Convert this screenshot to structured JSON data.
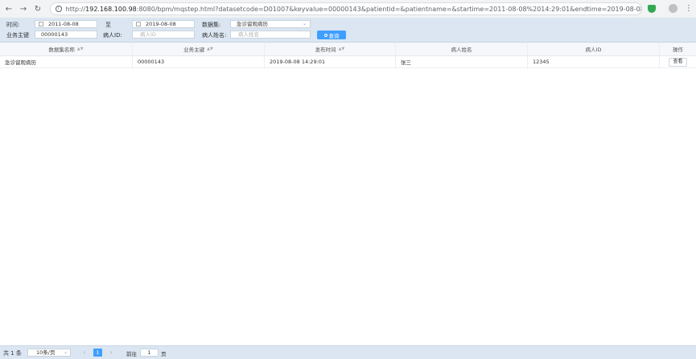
{
  "browser": {
    "url_host": "192.168.100.98",
    "url_rest": ":8080/bpm/mqstep.html?datasetcode=D01007&keyvalue=00000143&patientid=&patientname=&startime=2011-08-08%2014:29:01&endtime=2019-08-08%2014:..."
  },
  "filters": {
    "time_label": "时间:",
    "start_date": "2011-08-08",
    "to_label": "至",
    "end_date": "2019-08-08",
    "dataset_label": "数据集:",
    "dataset_value": "急诊留观病历",
    "business_key_label": "业务主键",
    "business_key_value": "00000143",
    "patient_id_label": "病人ID:",
    "patient_id_placeholder": "病人ID",
    "patient_name_label": "病人姓名:",
    "patient_name_placeholder": "病人姓名",
    "search_label": "查询"
  },
  "table": {
    "columns": [
      "数据集名称",
      "业务主键",
      "发布时间",
      "病人姓名",
      "病人ID",
      "操作"
    ],
    "rows": [
      {
        "dataset_name": "急诊留观病历",
        "business_key": "00000143",
        "publish_time": "2019-08-08 14:29:01",
        "patient_name": "张三",
        "patient_id": "12345",
        "action": "查看"
      }
    ]
  },
  "pagination": {
    "total": "共 1 条",
    "page_size": "10条/页",
    "current_page": "1",
    "goto_label": "前往",
    "goto_value": "1",
    "page_unit": "页"
  }
}
